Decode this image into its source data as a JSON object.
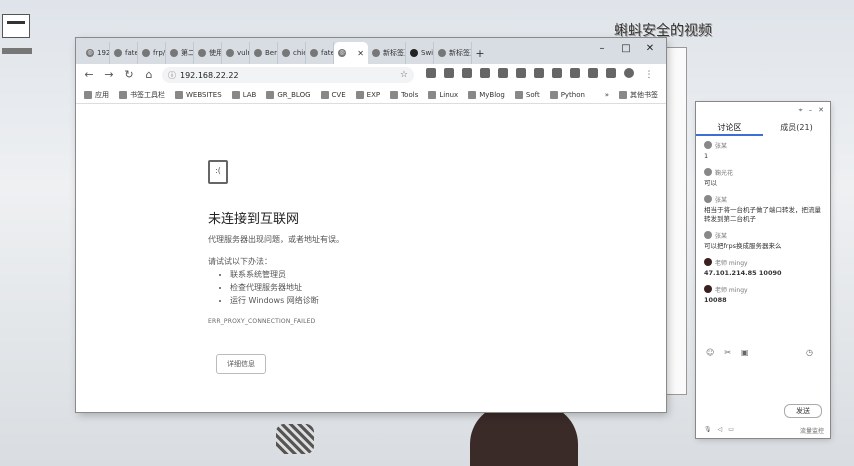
{
  "desktop": {
    "stream_title": "蝌蚪安全的视频"
  },
  "browser": {
    "tabs": [
      {
        "label": "192.",
        "icon": "globe"
      },
      {
        "label": "fate",
        "icon": "page"
      },
      {
        "label": "frp/",
        "icon": "page"
      },
      {
        "label": "第二",
        "icon": "page"
      },
      {
        "label": "使用",
        "icon": "page"
      },
      {
        "label": "vulr",
        "icon": "page"
      },
      {
        "label": "Bert",
        "icon": "page"
      },
      {
        "label": "chie",
        "icon": "page"
      },
      {
        "label": "fate",
        "icon": "page"
      },
      {
        "label": "",
        "icon": "globe",
        "active": true
      },
      {
        "label": "新标签页",
        "icon": "page"
      },
      {
        "label": "Swit",
        "icon": "github"
      },
      {
        "label": "新标签页",
        "icon": "page"
      }
    ],
    "new_tab": "+",
    "window_controls": {
      "minimize": "–",
      "maximize": "□",
      "close": "✕"
    },
    "address": "192.168.22.22",
    "bookmarks": [
      {
        "label": "应用"
      },
      {
        "label": "书签工具栏"
      },
      {
        "label": "WEBSITES"
      },
      {
        "label": "LAB"
      },
      {
        "label": "GR_BLOG"
      },
      {
        "label": "CVE"
      },
      {
        "label": "EXP"
      },
      {
        "label": "Tools"
      },
      {
        "label": "Linux"
      },
      {
        "label": "MyBlog"
      },
      {
        "label": "Soft"
      },
      {
        "label": "Python"
      }
    ],
    "bookmarks_more": "»",
    "other_bookmarks": "其他书签",
    "error": {
      "title": "未连接到互联网",
      "subtitle": "代理服务器出现问题，或者地址有误。",
      "try_label": "请试试以下办法：",
      "suggestions": [
        "联系系统管理员",
        "检查代理服务器地址",
        "运行 Windows 网络诊断"
      ],
      "code": "ERR_PROXY_CONNECTION_FAILED",
      "details_button": "详细信息"
    }
  },
  "panel": {
    "tabs": [
      "讨论区",
      "成员(21)"
    ],
    "messages": [
      {
        "user": "张某",
        "text": "1",
        "avatar": "light"
      },
      {
        "user": "鞠光花",
        "text": "可以",
        "avatar": "light"
      },
      {
        "user": "张某",
        "text": "相当于将一台机子做了端口转发，把流量转发到第二台机子",
        "avatar": "light"
      },
      {
        "user": "张某",
        "text": "可以把frps换成服务器来么",
        "avatar": "light"
      },
      {
        "user": "老师 mingy",
        "text": "47.101.214.85 10090",
        "avatar": "dark",
        "bold": true
      },
      {
        "user": "老师 mingy",
        "text": "10088",
        "avatar": "dark",
        "bold": true
      }
    ],
    "send_button": "发送",
    "bottom_status": "流量监控"
  }
}
